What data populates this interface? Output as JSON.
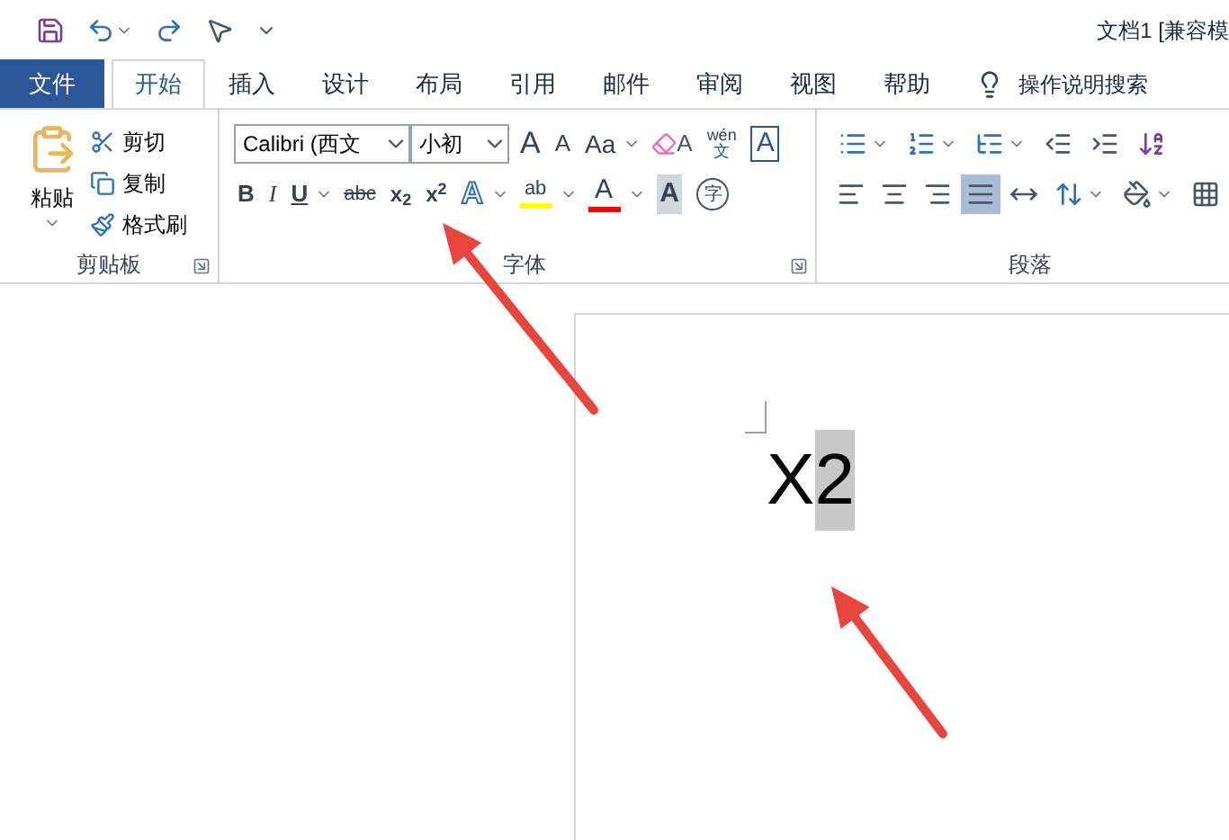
{
  "window": {
    "title": "文档1 [兼容模"
  },
  "tabs": [
    {
      "label": "文件",
      "selected": false,
      "kind": "file"
    },
    {
      "label": "开始",
      "selected": true,
      "kind": "tab"
    },
    {
      "label": "插入",
      "selected": false,
      "kind": "tab"
    },
    {
      "label": "设计",
      "selected": false,
      "kind": "tab"
    },
    {
      "label": "布局",
      "selected": false,
      "kind": "tab"
    },
    {
      "label": "引用",
      "selected": false,
      "kind": "tab"
    },
    {
      "label": "邮件",
      "selected": false,
      "kind": "tab"
    },
    {
      "label": "审阅",
      "selected": false,
      "kind": "tab"
    },
    {
      "label": "视图",
      "selected": false,
      "kind": "tab"
    },
    {
      "label": "帮助",
      "selected": false,
      "kind": "tab"
    }
  ],
  "tell_me": "操作说明搜索",
  "clipboard": {
    "paste": "粘贴",
    "items": [
      {
        "label": "剪切",
        "kind": "cut"
      },
      {
        "label": "复制",
        "kind": "copy"
      },
      {
        "label": "格式刷",
        "kind": "brush"
      }
    ],
    "group": "剪贴板"
  },
  "font": {
    "name": "Calibri (西文",
    "size": "小初",
    "group": "字体",
    "row1": [
      {
        "label": "A",
        "kind": "grow"
      },
      {
        "label": "A",
        "kind": "shrink"
      },
      {
        "label": "Aa",
        "kind": "case"
      },
      {
        "label": "A",
        "kind": "clear"
      },
      {
        "label": "wén",
        "sub_label": "文",
        "kind": "phonetic"
      },
      {
        "label": "A",
        "kind": "boxed"
      }
    ],
    "row2": [
      {
        "label": "B",
        "kind": "bold"
      },
      {
        "label": "I",
        "kind": "italic"
      },
      {
        "label": "U",
        "kind": "underline"
      },
      {
        "label": "abc",
        "kind": "strike"
      },
      {
        "label": "x$_{2}$",
        "kind": "sub"
      },
      {
        "label": "x$^{2}$",
        "kind": "sup"
      },
      {
        "label": "A",
        "kind": "effect"
      },
      {
        "label": "ab",
        "kind": "highlight",
        "color": "#ffff00"
      },
      {
        "label": "A",
        "kind": "fontcolor",
        "color": "#ff0000"
      },
      {
        "label": "A",
        "kind": "shaded"
      },
      {
        "label": "字",
        "kind": "circled"
      }
    ]
  },
  "paragraph": {
    "group": "段落",
    "alignment": [
      {
        "selected": false
      },
      {
        "selected": false
      },
      {
        "selected": false
      },
      {
        "selected": true
      },
      {
        "selected": false
      }
    ]
  },
  "document": {
    "text": "X",
    "selected_text": "2"
  }
}
